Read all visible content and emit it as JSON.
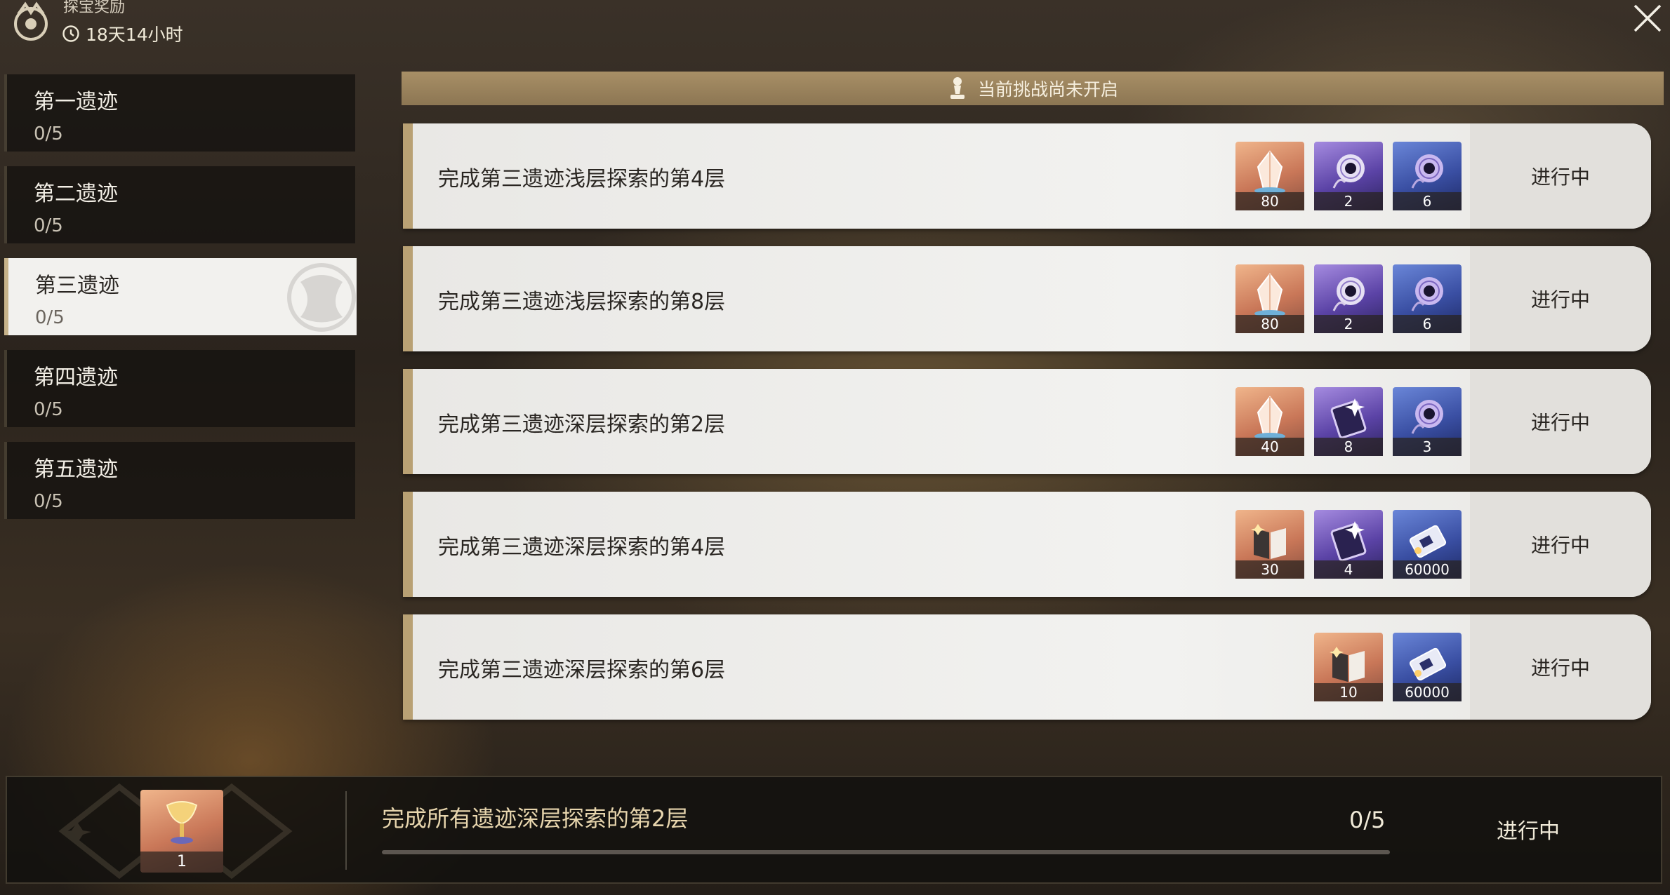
{
  "header": {
    "title": "探宝奖励",
    "timer": "18天14小时"
  },
  "sidebar": {
    "items": [
      {
        "name": "第一遗迹",
        "progress": "0/5",
        "active": false
      },
      {
        "name": "第二遗迹",
        "progress": "0/5",
        "active": false
      },
      {
        "name": "第三遗迹",
        "progress": "0/5",
        "active": true
      },
      {
        "name": "第四遗迹",
        "progress": "0/5",
        "active": false
      },
      {
        "name": "第五遗迹",
        "progress": "0/5",
        "active": false
      }
    ]
  },
  "banner": {
    "text": "当前挑战尚未开启"
  },
  "quests": [
    {
      "desc": "完成第三遗迹浅层探索的第4层",
      "status": "进行中",
      "rewards": [
        {
          "icon": "crystal-icon",
          "rarity": "orange",
          "qty": "80"
        },
        {
          "icon": "dark-orb-icon",
          "rarity": "purple",
          "qty": "2"
        },
        {
          "icon": "dark-orb-icon",
          "rarity": "blue",
          "qty": "6"
        }
      ]
    },
    {
      "desc": "完成第三遗迹浅层探索的第8层",
      "status": "进行中",
      "rewards": [
        {
          "icon": "crystal-icon",
          "rarity": "orange",
          "qty": "80"
        },
        {
          "icon": "dark-orb-icon",
          "rarity": "purple",
          "qty": "2"
        },
        {
          "icon": "dark-orb-icon",
          "rarity": "blue",
          "qty": "6"
        }
      ]
    },
    {
      "desc": "完成第三遗迹深层探索的第2层",
      "status": "进行中",
      "rewards": [
        {
          "icon": "crystal-icon",
          "rarity": "orange",
          "qty": "40"
        },
        {
          "icon": "record-card-icon",
          "rarity": "purple",
          "qty": "8"
        },
        {
          "icon": "dark-orb-icon",
          "rarity": "blue",
          "qty": "3"
        }
      ]
    },
    {
      "desc": "完成第三遗迹深层探索的第4层",
      "status": "进行中",
      "rewards": [
        {
          "icon": "book-icon",
          "rarity": "orange",
          "qty": "30"
        },
        {
          "icon": "record-card-icon",
          "rarity": "purple",
          "qty": "4"
        },
        {
          "icon": "credit-chip-icon",
          "rarity": "blue",
          "qty": "60000"
        }
      ]
    },
    {
      "desc": "完成第三遗迹深层探索的第6层",
      "status": "进行中",
      "rewards": [
        {
          "icon": "book-icon",
          "rarity": "orange",
          "qty": "10"
        },
        {
          "icon": "credit-chip-icon",
          "rarity": "blue",
          "qty": "60000"
        }
      ]
    }
  ],
  "bottom": {
    "desc": "完成所有遗迹深层探索的第2层",
    "count": "0/5",
    "progress_fraction": 0,
    "status": "进行中",
    "reward": {
      "icon": "golden-goblet-icon",
      "rarity": "orange",
      "qty": "1"
    }
  },
  "colors": {
    "accent_gold": "#b9a174",
    "banner": "#a88f66",
    "card_bg": "#f2f2f0",
    "orange_rarity": "#c97758",
    "purple_rarity": "#5b43a6",
    "blue_rarity": "#3a4fa3"
  }
}
